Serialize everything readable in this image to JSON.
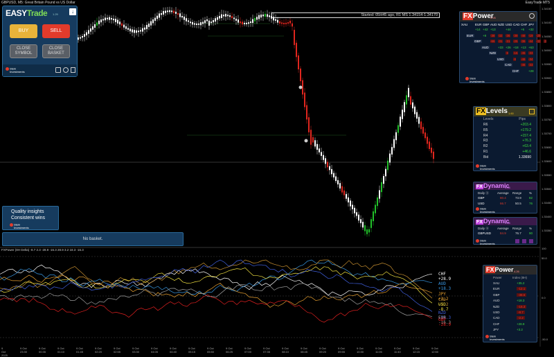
{
  "window": {
    "title": "GBPUSD, M5:  Great Britain Pound vs US Dollar",
    "right_title": "EasyTrade MT5"
  },
  "colors": {
    "bull": "#22c22a",
    "bear": "#e0261e",
    "candle": "#ffffff",
    "panel_blue": "#163b5e"
  },
  "easytrade": {
    "logo_easy": "EASY",
    "logo_trade": "Trade",
    "version": "1.29",
    "collapse_icon": "↓",
    "buy_label": "BUY",
    "sell_label": "SELL",
    "close_symbol_label": "CLOSE SYMBOL",
    "close_basket_label": "CLOSE BASKET",
    "brand_line1": "Stein",
    "brand_line2": "Investments"
  },
  "quality": {
    "line1": "Quality insights",
    "line2": "Consistent wins",
    "brand_line1": "Stein",
    "brand_line2": "Investments"
  },
  "basket": {
    "text": "No basket."
  },
  "started": {
    "text": "Started: 05H45 ago, R1 MS 1.34154-1.34170"
  },
  "fxpower": {
    "title_fx": "FX",
    "title_rest": "Power",
    "version": "4.26",
    "currencies": [
      "XAU",
      "EUR",
      "GBP",
      "AUD",
      "NZD",
      "USD",
      "CAD",
      "CHF",
      "JPY"
    ],
    "rows": [
      {
        "label": "XAU",
        "cells": [
          "+14",
          "+42",
          "+13",
          "",
          "+44",
          "",
          "+6",
          "+32"
        ]
      },
      {
        "label": "EUR",
        "cells": [
          "+8",
          "-38",
          "-32",
          "-36",
          "-39",
          "-48",
          "-19",
          "-29"
        ]
      },
      {
        "label": "GBP",
        "cells": [
          "-66",
          "-31",
          "-31",
          "-25",
          "-36",
          "-44",
          "-32",
          "-3"
        ]
      },
      {
        "label": "AUD",
        "cells": [
          "+33",
          "+26",
          "+18",
          "+13",
          "+63"
        ]
      },
      {
        "label": "NZD",
        "cells": [
          "-8",
          "-16",
          "-45",
          "-33"
        ]
      },
      {
        "label": "USD",
        "cells": [
          "-8",
          "-46",
          "-34"
        ]
      },
      {
        "label": "CAD",
        "cells": [
          "-46",
          "-33"
        ]
      },
      {
        "label": "CHF",
        "cells": [
          "+28"
        ]
      }
    ],
    "brand_line1": "Stein",
    "brand_line2": "Investments"
  },
  "fxlevels": {
    "title_fx": "FX",
    "title_rest": "Levels",
    "version": "1.60",
    "col_levels": "Levels",
    "col_pips": "Pips",
    "rows": [
      {
        "name": "R6",
        "value": "+203.4"
      },
      {
        "name": "R5",
        "value": "+179.2"
      },
      {
        "name": "R4",
        "value": "+157.4"
      },
      {
        "name": "R3",
        "value": "+76.3"
      },
      {
        "name": "R2",
        "value": "+63.4"
      },
      {
        "name": "R1",
        "value": "+46.6"
      },
      {
        "name": "Bid",
        "value": "1.33690"
      }
    ],
    "brand_line1": "Stein",
    "brand_line2": "Investments"
  },
  "dynamic1": {
    "title_fx": "FX",
    "title_rest": "Dynamic",
    "version": "1.44",
    "col_name": "Daily ⓐ",
    "col_avg": "Average",
    "col_range": "Range",
    "col_pct": "%",
    "rows": [
      {
        "name": "GBP",
        "avg": "80.4",
        "range": "73.9",
        "pct": "82"
      },
      {
        "name": "USD",
        "avg": "66.7",
        "range": "50.5",
        "pct": "76"
      }
    ],
    "brand_line1": "Stein",
    "brand_line2": "Investments"
  },
  "dynamic2": {
    "title_fx": "FX",
    "title_rest": "Dynamic",
    "version": "1.44",
    "col_name": "Daily ⓐ",
    "col_avg": "Average",
    "col_range": "Range",
    "col_pct": "%",
    "rows": [
      {
        "name": "GBPUSD",
        "avg": "84.9",
        "range": "76.7",
        "pct": "90"
      }
    ],
    "brand_line1": "Stein",
    "brand_line2": "Investments"
  },
  "fxpower2": {
    "title_fx": "FX",
    "title_rest": "Power",
    "version": "4.26",
    "col_name": "Power",
    "col_index": "Index (8H)",
    "rows": [
      {
        "name": "XAU",
        "value": "+35.2",
        "sign": "pos"
      },
      {
        "name": "EUR",
        "value": "-12.1",
        "sign": "neg"
      },
      {
        "name": "GBP",
        "value": "-38.6",
        "sign": "neg"
      },
      {
        "name": "AUD",
        "value": "+18.3",
        "sign": "pos"
      },
      {
        "name": "NZD",
        "value": "-16.3",
        "sign": "neg"
      },
      {
        "name": "USD",
        "value": "-8.7",
        "sign": "neg"
      },
      {
        "name": "CAD",
        "value": "-2.2",
        "sign": "neg"
      },
      {
        "name": "CHF",
        "value": "+28.9",
        "sign": "pos"
      },
      {
        "name": "JPY",
        "value": "+3.2",
        "sign": "pos"
      }
    ],
    "brand_line1": "Stein",
    "brand_line2": "Investments"
  },
  "indicator": {
    "title": "FXPower (8H Delta)  -8.7  2.3  -28.9  -16.3  28.9  3.2  18.3  -16.3",
    "labels": [
      {
        "text": "CHF +28.9",
        "color": "#ffffff"
      },
      {
        "text": "AUD +18.3",
        "color": "#3a9be8"
      },
      {
        "text": "JPY +3.2",
        "color": "#e8a030"
      },
      {
        "text": "CAD -2.2",
        "color": "#c89030"
      },
      {
        "text": "USD -8.7",
        "color": "#f0e040"
      },
      {
        "text": "NZD -16.3",
        "color": "#4060e0"
      },
      {
        "text": "EUR -16.3",
        "color": "#a0a0a0"
      },
      {
        "text": "GBP -28.9",
        "color": "#e02020"
      }
    ],
    "axis": [
      "100",
      "50.0",
      "0.0",
      "-50.0"
    ]
  },
  "price_axis": [
    "1.34150",
    "1.34100",
    "1.34050",
    "1.34000",
    "1.33950",
    "1.33900",
    "1.33850",
    "1.33800",
    "1.33750",
    "1.33700",
    "1.33650",
    "1.33600",
    "1.33550",
    "1.33500",
    "1.33450",
    "1.33400",
    "1.33350"
  ],
  "time_axis": [
    "9 Oct 2025",
    "9 Oct 23:30",
    "9 Oct 00:35",
    "9 Oct 01:10",
    "9 Oct 01:45",
    "9 Oct 02:20",
    "9 Oct 02:55",
    "9 Oct 03:30",
    "9 Oct 04:05",
    "9 Oct 04:40",
    "9 Oct 05:15",
    "9 Oct 05:50",
    "9 Oct 06:25",
    "9 Oct 07:00",
    "9 Oct 07:35",
    "9 Oct 08:10",
    "9 Oct 08:45",
    "9 Oct 09:20",
    "9 Oct 09:55",
    "9 Oct 10:30",
    "9 Oct 11:05",
    "9 Oct 11:40",
    "9 Oct 12:15",
    "9 Oct 12:50"
  ]
}
